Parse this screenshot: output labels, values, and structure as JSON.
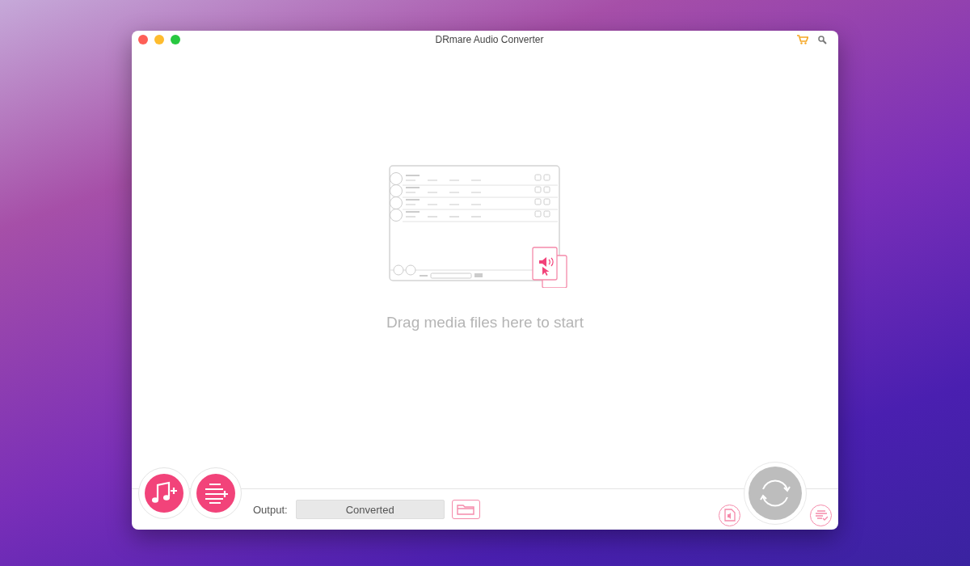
{
  "window": {
    "title": "DRmare Audio Converter"
  },
  "drop_zone": {
    "hint": "Drag media files here to start"
  },
  "output": {
    "label": "Output:",
    "value": "Converted"
  }
}
